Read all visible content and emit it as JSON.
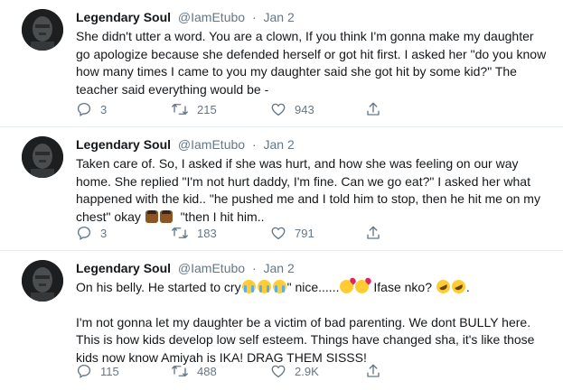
{
  "tweets": [
    {
      "name": "Legendary Soul",
      "handle": "@IamEtubo",
      "separator": "·",
      "date": "Jan 2",
      "paragraphs": [
        "She didn't utter a word. You are a clown, If you think I'm gonna make my daughter go apologize because she defended herself or got hit first. I asked her \"do you know how many times I came to you my daughter said she got hit by some kid?\" The teacher said everything would be -"
      ],
      "replies": "3",
      "retweets": "215",
      "likes": "943"
    },
    {
      "name": "Legendary Soul",
      "handle": "@IamEtubo",
      "separator": "·",
      "date": "Jan 2",
      "text_a": "Taken care of. So, I asked if she was hurt, and how she was feeling on our way home. She replied \"I'm not hurt daddy, I'm fine. Can we go eat?\" I asked her what happened with the kid.. \"he pushed me and I told him to stop, then he hit me on my chest\" okay",
      "text_b": "\"then I hit him..",
      "replies": "3",
      "retweets": "183",
      "likes": "791"
    },
    {
      "name": "Legendary Soul",
      "handle": "@IamEtubo",
      "separator": "·",
      "date": "Jan 2",
      "text_a": "On his belly. He started to cry",
      "text_b": "\" nice......",
      "text_c": "Ifase nko?",
      "text_d": ".",
      "paragraph2": "I'm not gonna let my daughter be a victim of bad parenting. We dont BULLY here. This is how kids develop low self esteem. Things have changed sha, it's like those kids now know Amiyah is IKA! DRAG THEM SISSS!",
      "replies": "115",
      "retweets": "488",
      "likes": "2.9K"
    }
  ],
  "icons": [
    "reply-icon",
    "retweet-icon",
    "like-icon",
    "share-icon",
    "loudly-crying-face-emoji",
    "face-blowing-kiss-emoji",
    "rolling-on-floor-laughing-emoji",
    "man-shrugging-emoji"
  ],
  "colors": {
    "text": "#14171a",
    "secondary": "#657786",
    "divider": "#e6ecf0"
  }
}
